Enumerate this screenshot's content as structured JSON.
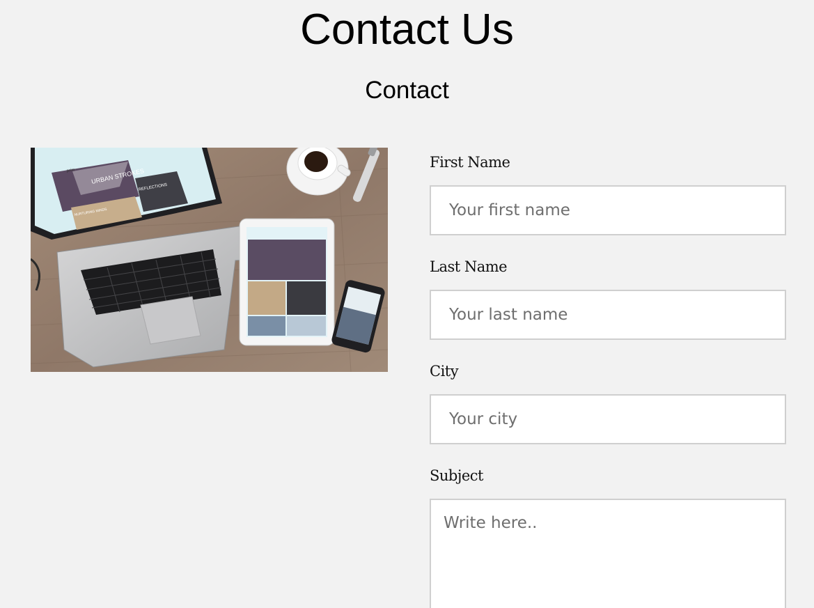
{
  "header": {
    "title": "Contact Us",
    "subtitle": "Contact"
  },
  "hero_image": {
    "screen_brand": "prim",
    "screen_headline": "URBAN STROKES",
    "screen_panel_left": "NURTURING MINDS",
    "screen_panel_right": "REFLECTIONS"
  },
  "form": {
    "first_name": {
      "label": "First Name",
      "placeholder": "Your first name"
    },
    "last_name": {
      "label": "Last Name",
      "placeholder": "Your last name"
    },
    "city": {
      "label": "City",
      "placeholder": "Your city"
    },
    "subject": {
      "label": "Subject",
      "placeholder": "Write here.."
    }
  },
  "colors": {
    "background": "#f2f2f2",
    "input_border": "#cfcfcf",
    "input_background": "#ffffff"
  }
}
